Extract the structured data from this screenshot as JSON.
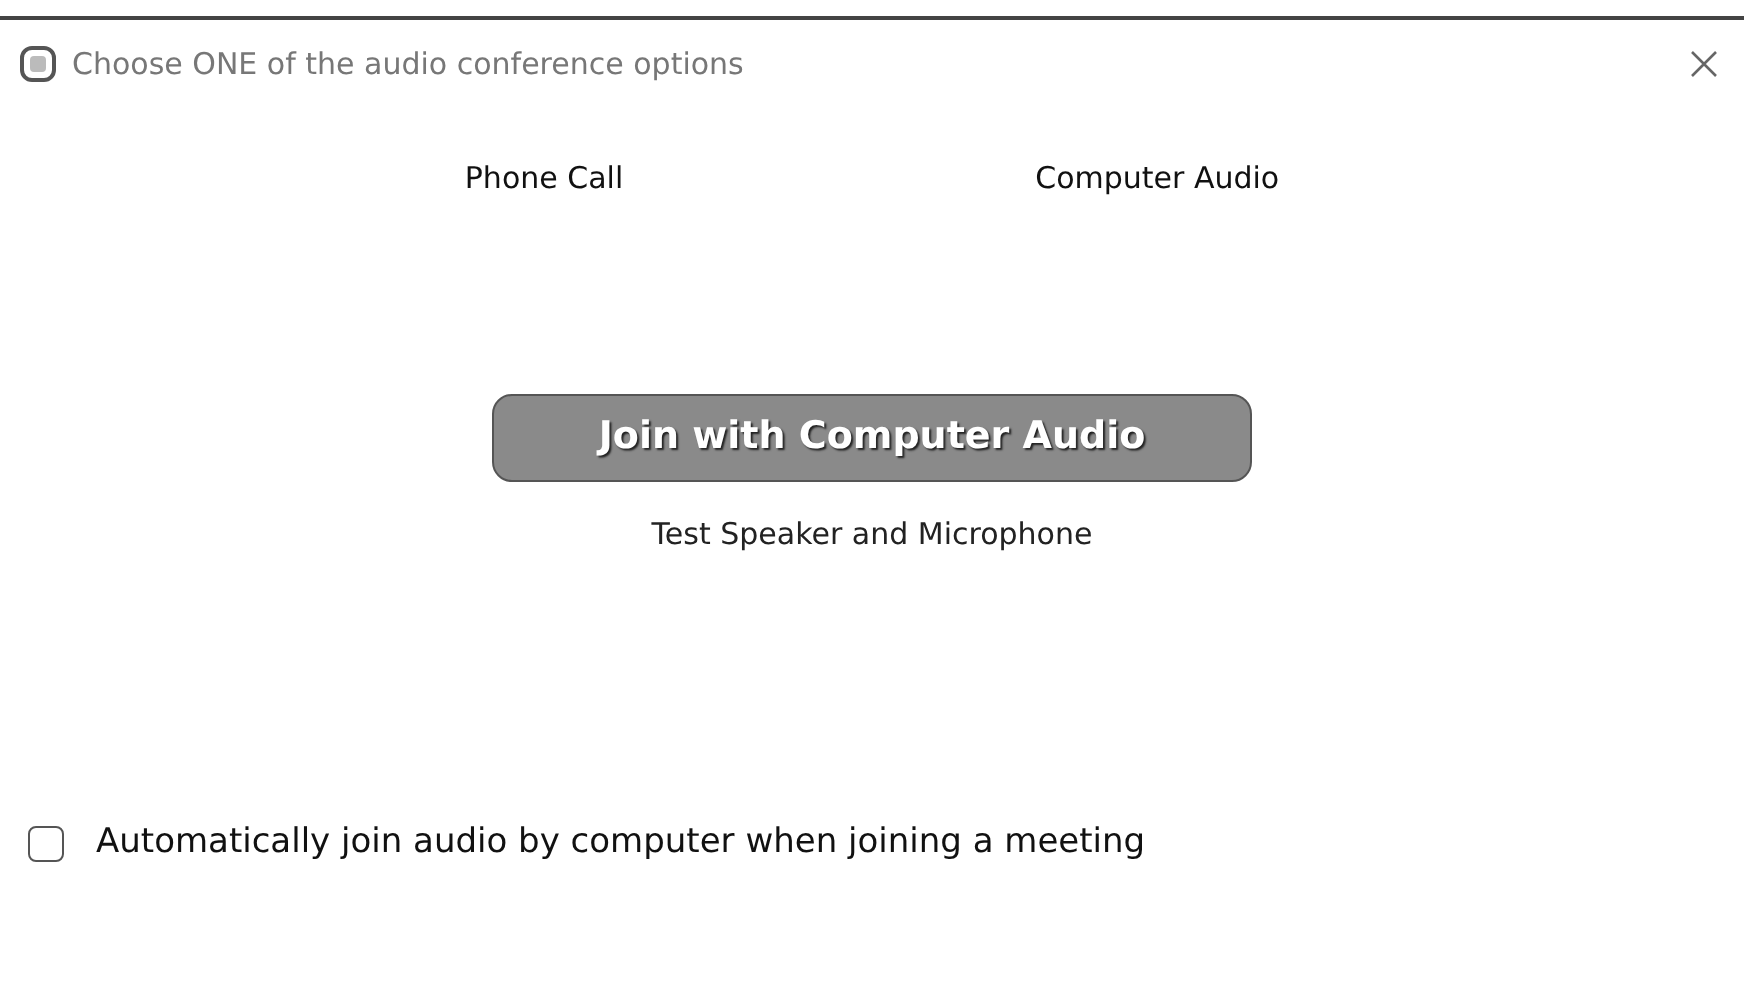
{
  "window": {
    "title": "Choose ONE of the audio conference options"
  },
  "tabs": [
    {
      "label": "Phone Call"
    },
    {
      "label": "Computer Audio"
    }
  ],
  "join_button": {
    "label": "Join with Computer Audio"
  },
  "test_link": {
    "label": "Test Speaker and Microphone"
  },
  "auto_join": {
    "label": "Automatically join audio by computer when joining a meeting",
    "checked": false
  }
}
